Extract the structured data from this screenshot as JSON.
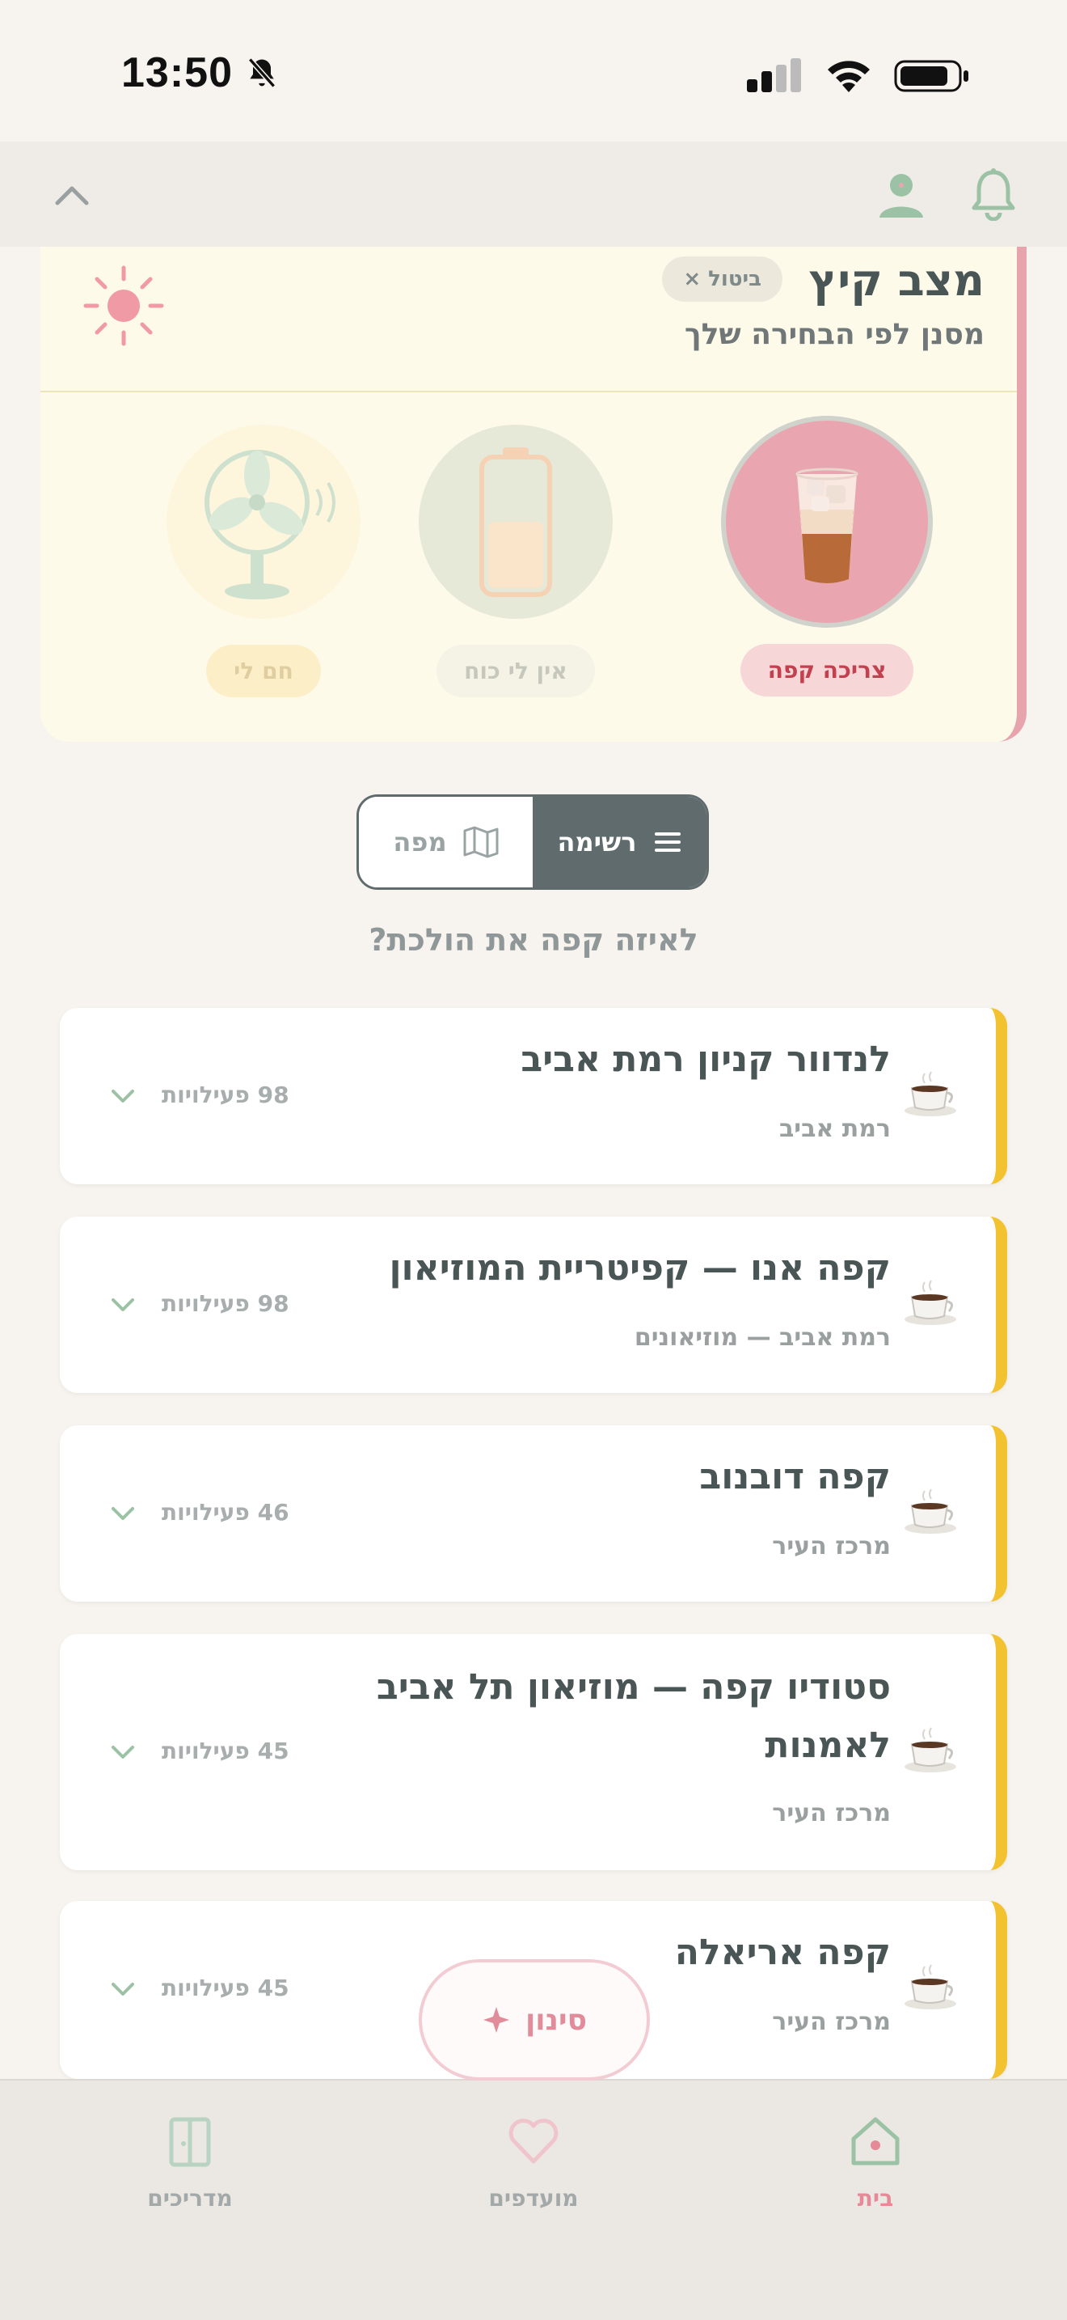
{
  "status_bar": {
    "time": "13:50"
  },
  "summer_mode": {
    "title": "מצב קיץ",
    "cancel_label": "ביטול ×",
    "subtitle": "מסנן לפי הבחירה שלך",
    "moods": [
      {
        "label": "צריכה קפה",
        "selected": true
      },
      {
        "label": "אין לי כוח",
        "selected": false
      },
      {
        "label": "חם לי",
        "selected": false
      }
    ]
  },
  "view_toggle": {
    "list_label": "רשימה",
    "map_label": "מפה",
    "active": "list"
  },
  "question": "לאיזה קפה את הולכת?",
  "cafes": [
    {
      "name": "לנדוור קניון רמת אביב",
      "area": "רמת אביב",
      "count": "98 פעילויות"
    },
    {
      "name": "קפה אנו — קפיטריית המוזיאון",
      "area": "רמת אביב — מוזיאונים",
      "count": "98 פעילויות"
    },
    {
      "name": "קפה דובנוב",
      "area": "מרכז העיר",
      "count": "46 פעילויות"
    },
    {
      "name": "סטודיו קפה — מוזיאון תל אביב לאמנות",
      "area": "מרכז העיר",
      "count": "45 פעילויות"
    },
    {
      "name": "קפה אריאלה",
      "area": "מרכז העיר",
      "count": "45 פעילויות"
    }
  ],
  "filter_button": {
    "label": "סינון"
  },
  "bottom_nav": [
    {
      "label": "בית",
      "icon": "home-icon",
      "active": true
    },
    {
      "label": "מועדפים",
      "icon": "heart-icon",
      "active": false
    },
    {
      "label": "מדריכים",
      "icon": "guides-icon",
      "active": false
    }
  ],
  "colors": {
    "accent_pink": "#e58a96",
    "card_stripe_yellow": "#f3c230",
    "toggle_active": "#5f6b6c",
    "summer_card_bg": "#fefaea"
  }
}
